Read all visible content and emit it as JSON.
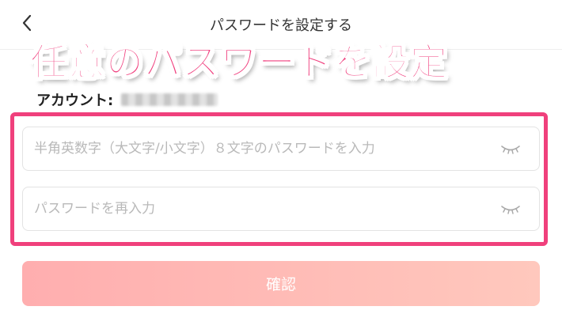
{
  "header": {
    "title": "パスワードを設定する",
    "back_icon": "chevron-left-icon"
  },
  "overlay": {
    "caption": "任意のパスワードを設定"
  },
  "account": {
    "label": "アカウント:"
  },
  "form": {
    "password_placeholder": "半角英数字（大文字/小文字）８文字のパスワードを入力",
    "password_value": "",
    "confirm_placeholder": "パスワードを再入力",
    "confirm_value": "",
    "eye_icon": "eye-closed-icon"
  },
  "confirm_button": {
    "label": "確認"
  },
  "colors": {
    "highlight": "#f0407c",
    "button_gradient_start": "#ffaeaf",
    "button_gradient_end": "#ffc8bd",
    "placeholder": "#b9b9b9"
  }
}
